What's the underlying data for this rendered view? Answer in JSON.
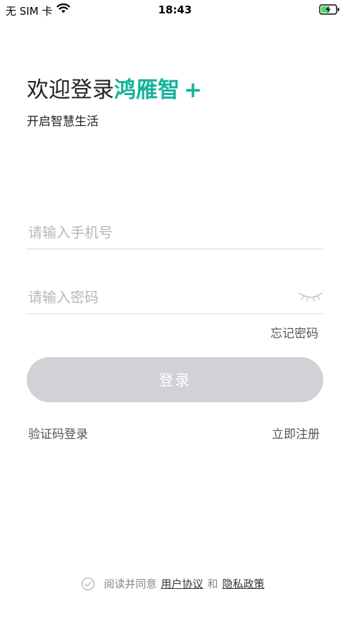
{
  "status_bar": {
    "carrier": "无 SIM 卡",
    "time": "18:43",
    "wifi_icon": "wifi-icon",
    "battery_icon": "battery-charging-icon",
    "battery_color": "#4cd964"
  },
  "header": {
    "welcome_prefix": "欢迎登录",
    "brand_name": "鸿雁智",
    "brand_plus": "+",
    "subtitle": "开启智慧生活",
    "brand_color": "#16b39a"
  },
  "form": {
    "phone_placeholder": "请输入手机号",
    "phone_value": "",
    "password_placeholder": "请输入密码",
    "password_value": "",
    "eye_icon": "eye-closed-icon",
    "forgot_label": "忘记密码",
    "login_label": "登录",
    "login_button_color": "#d1d1d6",
    "sms_login_label": "验证码登录",
    "register_label": "立即注册"
  },
  "agreement": {
    "check_icon": "check-circle-icon",
    "text": "阅读并同意",
    "user_agreement": "用户协议",
    "and_text": "和",
    "privacy_policy": "隐私政策"
  }
}
